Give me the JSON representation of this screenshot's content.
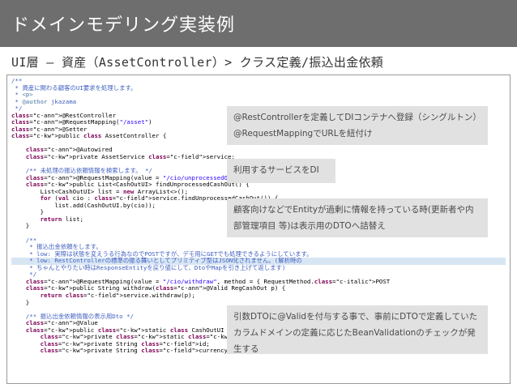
{
  "slide": {
    "title": "ドメインモデリング実装例",
    "subtitle": "UI層 – 資産（AssetController）> クラス定義/振込出金依頼"
  },
  "code_lines": [
    "/**",
    " * 資産に関わる顧客のUI要求を処理します。",
    " * <p>",
    " * @author jkazama",
    " */",
    "@RestController",
    "@RequestMapping(\"/asset\")",
    "@Setter",
    "public class AssetController {",
    "",
    "    @Autowired",
    "    private AssetService service;",
    "",
    "    /** 未処理の振込依頼情報を検索します。 */",
    "    @RequestMapping(value = \"/cio/unprocessedOut\")",
    "    public List<CashOutUI> findUnprocessedCashOut() {",
    "        List<CashOutUI> list = new ArrayList<>();",
    "        for (val cio : service.findUnprocessedCashOut()) {",
    "            list.add(CashOutUI.by(cio));",
    "        }",
    "        return list;",
    "    }",
    "",
    "    /**",
    "     * 振込出金依頼をします。",
    "     * low: 実際は状態を変えうる行為なのでPOSTですが、デモ用にGETでも処理できるようにしています。",
    "     * low: RestControllerの標準の振る舞いとしてプリミティブ型はJSON化されません。(解析時の",
    "     * ちゃんとやりたい時はResponseEntityを戻り値にして、DtoやMapを引き上げて返します)",
    "     */",
    "    @RequestMapping(value = \"/cio/withdraw\", method = { RequestMethod.POST",
    "    public String withdraw(@Valid RegCashOut p) {",
    "        return service.withdraw(p);",
    "    }",
    "",
    "    /** 振込出金依頼情報の表示用Dto */",
    "    @Value",
    "    public static class CashOutUI implements Dto {",
    "        private static final long serialVersionUID = 1L;",
    "        private String id;",
    "        private String currency;"
  ],
  "callouts": [
    {
      "line1": "@RestControllerを定義してDIコンテナへ登録（シングルトン）",
      "line2": "@RequestMappingでURLを紐付け"
    },
    {
      "line1": "利用するサービスをDI"
    },
    {
      "line1": "顧客向けなどでEntityが過剰に情報を持っている時(更新者や内",
      "line2": "部管理項目 等)は表示用のDTOへ詰替え"
    },
    {
      "line1": "引数DTOに@Validを付与する事で、事前にDTOで定義していた",
      "line2": "カラムドメインの定義に応じたBeanValidationのチェックが発",
      "line3": "生する"
    }
  ],
  "colors": {
    "title_bar": "#6e6e6e",
    "callout_bg": "#e1e1e1",
    "callout_text": "#4a4a4a",
    "code_comment": "#3f5fbf",
    "code_keyword": "#7f0055",
    "code_string": "#2a00ff",
    "code_annotation": "#646464",
    "highlight_row": "#d8e6f4"
  }
}
